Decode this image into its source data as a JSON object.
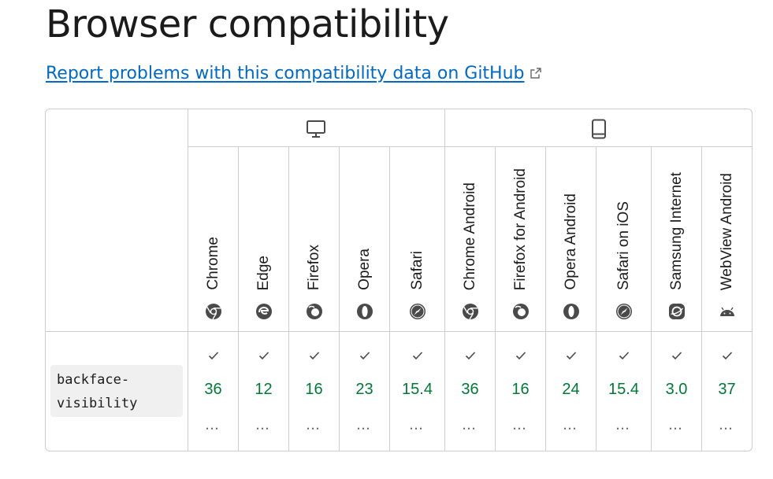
{
  "page": {
    "title": "Browser compatibility",
    "report_link": "Report problems with this compatibility data on GitHub"
  },
  "platforms": [
    {
      "name": "desktop",
      "icon": "desktop-icon"
    },
    {
      "name": "mobile",
      "icon": "mobile-icon"
    }
  ],
  "browsers": [
    {
      "name": "Chrome",
      "icon": "chrome-icon"
    },
    {
      "name": "Edge",
      "icon": "edge-icon"
    },
    {
      "name": "Firefox",
      "icon": "firefox-icon"
    },
    {
      "name": "Opera",
      "icon": "opera-icon"
    },
    {
      "name": "Safari",
      "icon": "safari-icon"
    },
    {
      "name": "Chrome Android",
      "icon": "chrome-icon"
    },
    {
      "name": "Firefox for Android",
      "icon": "firefox-icon"
    },
    {
      "name": "Opera Android",
      "icon": "opera-icon"
    },
    {
      "name": "Safari on iOS",
      "icon": "safari-icon"
    },
    {
      "name": "Samsung Internet",
      "icon": "samsung-internet-icon"
    },
    {
      "name": "WebView Android",
      "icon": "android-icon"
    }
  ],
  "feature": {
    "name_line1": "backface-",
    "name_line2": "visibility",
    "support": [
      {
        "version": "36",
        "more": "…"
      },
      {
        "version": "12",
        "more": "…"
      },
      {
        "version": "16",
        "more": "…"
      },
      {
        "version": "23",
        "more": "…"
      },
      {
        "version": "15.4",
        "more": "…"
      },
      {
        "version": "36",
        "more": "…"
      },
      {
        "version": "16",
        "more": "…"
      },
      {
        "version": "24",
        "more": "…"
      },
      {
        "version": "15.4",
        "more": "…"
      },
      {
        "version": "3.0",
        "more": "…"
      },
      {
        "version": "37",
        "more": "…"
      }
    ]
  },
  "colors": {
    "link": "#0069c2",
    "supported": "#007936",
    "border": "#cdcdcd",
    "feature_bg": "#f0f0f0"
  }
}
